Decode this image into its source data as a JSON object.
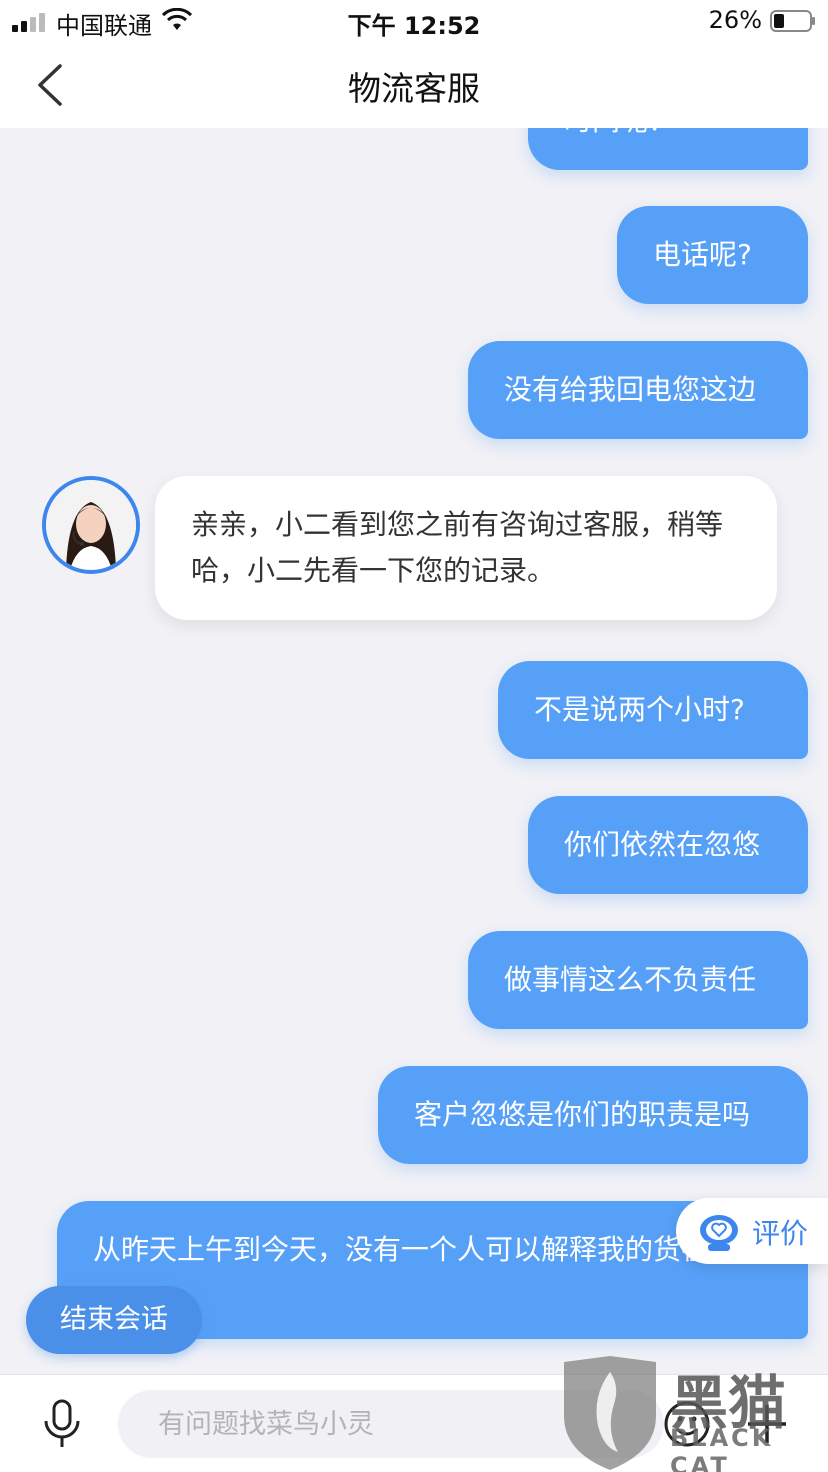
{
  "status_bar": {
    "carrier": "中国联通",
    "time": "下午 12:52",
    "battery": "26%"
  },
  "header": {
    "title": "物流客服"
  },
  "messages": [
    {
      "from": "user",
      "text": "时间呢？"
    },
    {
      "from": "user",
      "text": "电话呢?"
    },
    {
      "from": "user",
      "text": "没有给我回电您这边"
    },
    {
      "from": "agent",
      "text": "亲亲，小二看到您之前有咨询过客服，稍等哈，小二先看一下您的记录。"
    },
    {
      "from": "user",
      "text": "不是说两个小时?"
    },
    {
      "from": "user",
      "text": "你们依然在忽悠"
    },
    {
      "from": "user",
      "text": "做事情这么不负责任"
    },
    {
      "from": "user",
      "text": "客户忽悠是你们的职责是吗"
    },
    {
      "from": "user",
      "text": "从昨天上午到今天，没有一个人可以解释我的货在哪里"
    }
  ],
  "rate_button": {
    "label": "评价"
  },
  "end_button": {
    "label": "结束会话"
  },
  "input": {
    "placeholder": "有问题找菜鸟小灵",
    "value": ""
  },
  "watermark": {
    "cn": "黑猫",
    "en": "BLACK CAT"
  },
  "colors": {
    "bubble_user": "#57a0f7",
    "accent": "#3d86ee",
    "background": "#f1f1f6"
  },
  "icons": [
    "signal-icon",
    "wifi-icon",
    "battery-icon",
    "back-arrow-icon",
    "avatar",
    "rate-icon",
    "microphone-icon",
    "emoji-icon",
    "plus-icon"
  ]
}
